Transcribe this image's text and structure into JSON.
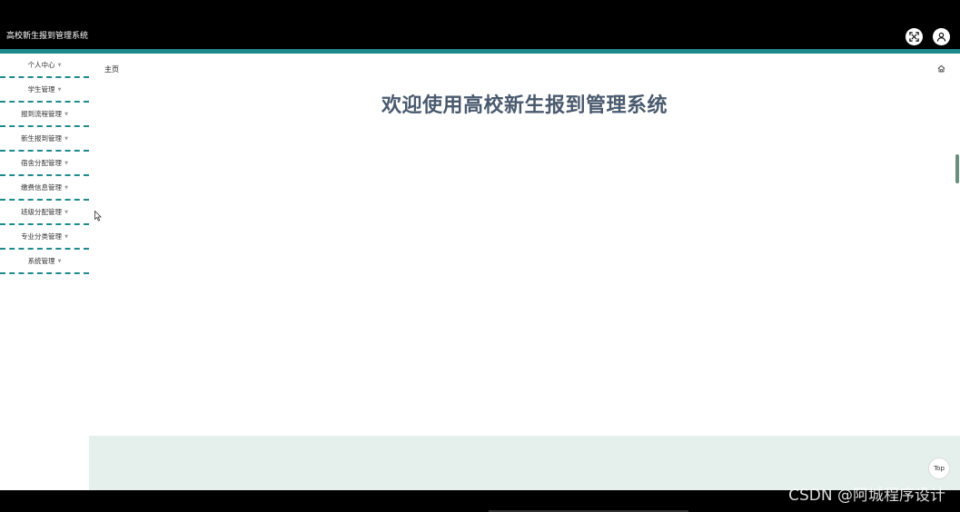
{
  "header": {
    "title": "高校新生报到管理系统",
    "fullscreen_icon": "fullscreen-icon",
    "user_icon": "user-icon"
  },
  "sidebar": {
    "items": [
      {
        "label": "个人中心"
      },
      {
        "label": "学生管理"
      },
      {
        "label": "报到流程管理"
      },
      {
        "label": "新生报到管理"
      },
      {
        "label": "宿舍分配管理"
      },
      {
        "label": "缴费信息管理"
      },
      {
        "label": "班级分配管理"
      },
      {
        "label": "专业分类管理"
      },
      {
        "label": "系统管理"
      }
    ],
    "caret_icon": "caret-down-icon"
  },
  "main": {
    "breadcrumb": "主页",
    "home_icon": "home-icon",
    "welcome": "欢迎使用高校新生报到管理系统",
    "top_button": "Top"
  },
  "watermark": "CSDN @阿城程序设计",
  "colors": {
    "accent": "#1d8a8c",
    "welcome_text": "#4a5a6e",
    "footer_band": "#e5efec",
    "header_bg": "#000000"
  }
}
